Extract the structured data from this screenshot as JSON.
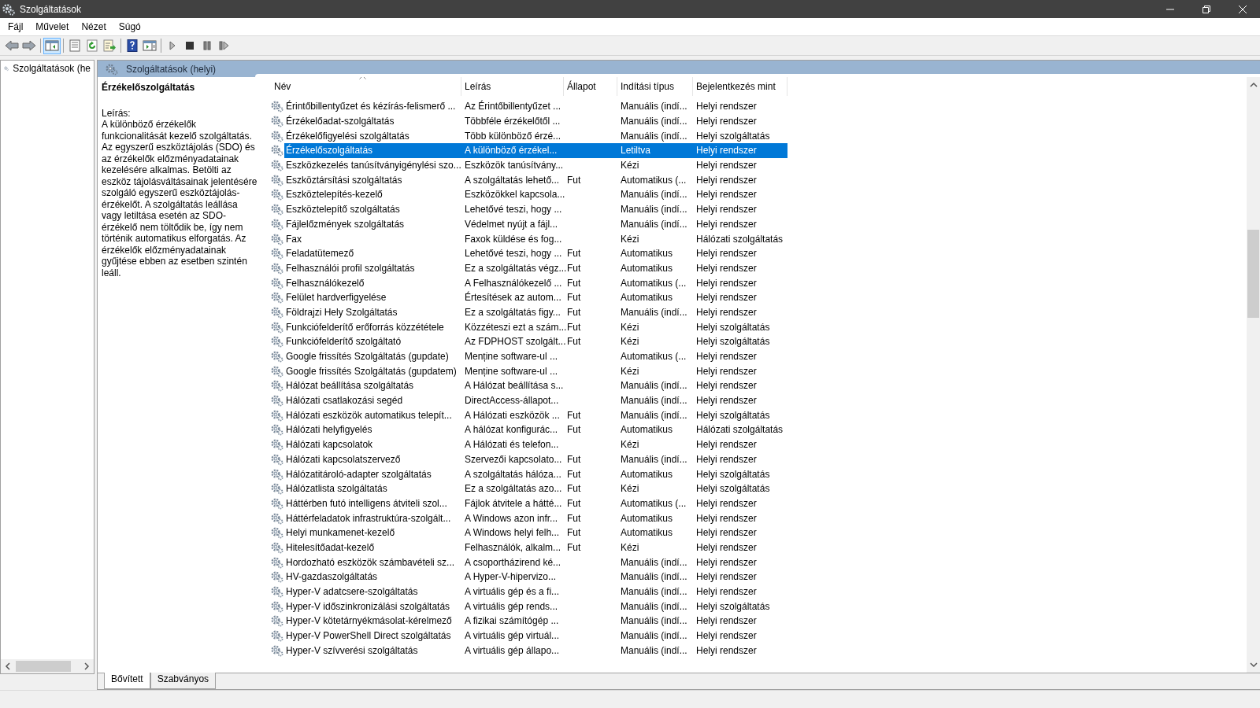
{
  "window": {
    "title": "Szolgáltatások"
  },
  "menu": [
    "Fájl",
    "Művelet",
    "Nézet",
    "Súgó"
  ],
  "toolbar": [
    {
      "kind": "back",
      "pressed": false
    },
    {
      "kind": "forward",
      "pressed": false
    },
    {
      "kind": "separator"
    },
    {
      "kind": "tree",
      "pressed": true
    },
    {
      "kind": "separator"
    },
    {
      "kind": "properties",
      "pressed": false
    },
    {
      "kind": "refresh",
      "pressed": false
    },
    {
      "kind": "export",
      "pressed": false
    },
    {
      "kind": "separator"
    },
    {
      "kind": "help",
      "pressed": false
    },
    {
      "kind": "panel",
      "pressed": false
    },
    {
      "kind": "separator"
    },
    {
      "kind": "play",
      "pressed": false
    },
    {
      "kind": "stop",
      "pressed": false
    },
    {
      "kind": "pause",
      "pressed": false
    },
    {
      "kind": "resume",
      "pressed": false
    }
  ],
  "tree": {
    "items": [
      {
        "label": "Szolgáltatások (he",
        "selected": false
      }
    ]
  },
  "panel": {
    "title": "Szolgáltatások (helyi)"
  },
  "details": {
    "name": "Érzékelőszolgáltatás",
    "label": "Leírás:",
    "text": "A különböző érzékelők funkcionalitását kezelő szolgáltatás. Az egyszerű eszköztájolás (SDO) és az érzékelők előzményadatainak kezelésére alkalmas. Betölti az eszköz tájolásváltásainak jelentésére szolgáló egyszerű eszköztájolás-érzékelőt. A szolgáltatás leállása vagy letiltása esetén az SDO-érzékelő nem töltődik be, így nem történik automatikus elforgatás. Az érzékelők előzményadatainak gyűjtése ebben az esetben szintén leáll."
  },
  "table": {
    "columns": [
      "Név",
      "Leírás",
      "Állapot",
      "Indítási típus",
      "Bejelentkezés mint"
    ],
    "rows": [
      {
        "name": "Érintőbillentyűzet és kézírás-felismerő ...",
        "description": "Az Érintőbillentyűzet ...",
        "status": "",
        "startup": "Manuális (indí...",
        "logon": "Helyi rendszer",
        "selected": false
      },
      {
        "name": "Érzékelőadat-szolgáltatás",
        "description": "Többféle érzékelőtől ...",
        "status": "",
        "startup": "Manuális (indí...",
        "logon": "Helyi rendszer",
        "selected": false
      },
      {
        "name": "Érzékelőfigyelési szolgáltatás",
        "description": "Több különböző érzé...",
        "status": "",
        "startup": "Manuális (indí...",
        "logon": "Helyi szolgáltatás",
        "selected": false
      },
      {
        "name": "Érzékelőszolgáltatás",
        "description": "A különböző érzékel...",
        "status": "",
        "startup": "Letiltva",
        "logon": "Helyi rendszer",
        "selected": true
      },
      {
        "name": "Eszközkezelés tanúsítványigénylési szo...",
        "description": "Eszközök tanúsítvány...",
        "status": "",
        "startup": "Kézi",
        "logon": "Helyi rendszer",
        "selected": false
      },
      {
        "name": "Eszköztársítási szolgáltatás",
        "description": "A szolgáltatás lehető...",
        "status": "Fut",
        "startup": "Automatikus (...",
        "logon": "Helyi rendszer",
        "selected": false
      },
      {
        "name": "Eszköztelepítés-kezelő",
        "description": "Eszközökkel kapcsola...",
        "status": "",
        "startup": "Manuális (indí...",
        "logon": "Helyi rendszer",
        "selected": false
      },
      {
        "name": "Eszköztelepítő szolgáltatás",
        "description": "Lehetővé teszi, hogy ...",
        "status": "",
        "startup": "Manuális (indí...",
        "logon": "Helyi rendszer",
        "selected": false
      },
      {
        "name": "Fájlelőzmények szolgáltatás",
        "description": "Védelmet nyújt a fájl...",
        "status": "",
        "startup": "Manuális (indí...",
        "logon": "Helyi rendszer",
        "selected": false
      },
      {
        "name": "Fax",
        "description": "Faxok küldése és fog...",
        "status": "",
        "startup": "Kézi",
        "logon": "Hálózati szolgáltatás",
        "selected": false
      },
      {
        "name": "Feladatütemező",
        "description": "Lehetővé teszi, hogy ...",
        "status": "Fut",
        "startup": "Automatikus",
        "logon": "Helyi rendszer",
        "selected": false
      },
      {
        "name": "Felhasználói profil szolgáltatás",
        "description": "Ez a szolgáltatás végz...",
        "status": "Fut",
        "startup": "Automatikus",
        "logon": "Helyi rendszer",
        "selected": false
      },
      {
        "name": "Felhasználókezelő",
        "description": "A Felhasználókezelő ...",
        "status": "Fut",
        "startup": "Automatikus (...",
        "logon": "Helyi rendszer",
        "selected": false
      },
      {
        "name": "Felület hardverfigyelése",
        "description": "Értesítések az autom...",
        "status": "Fut",
        "startup": "Automatikus",
        "logon": "Helyi rendszer",
        "selected": false
      },
      {
        "name": "Földrajzi Hely Szolgáltatás",
        "description": "Ez a szolgáltatás figy...",
        "status": "Fut",
        "startup": "Manuális (indí...",
        "logon": "Helyi rendszer",
        "selected": false
      },
      {
        "name": "Funkciófelderítő erőforrás közzététele",
        "description": "Közzéteszi ezt a szám...",
        "status": "Fut",
        "startup": "Kézi",
        "logon": "Helyi szolgáltatás",
        "selected": false
      },
      {
        "name": "Funkciófelderítő szolgáltató",
        "description": "Az FDPHOST szolgált...",
        "status": "Fut",
        "startup": "Kézi",
        "logon": "Helyi szolgáltatás",
        "selected": false
      },
      {
        "name": "Google frissítés Szolgáltatás (gupdate)",
        "description": "Menține software-ul ...",
        "status": "",
        "startup": "Automatikus (...",
        "logon": "Helyi rendszer",
        "selected": false
      },
      {
        "name": "Google frissítés Szolgáltatás (gupdatem)",
        "description": "Menține software-ul ...",
        "status": "",
        "startup": "Kézi",
        "logon": "Helyi rendszer",
        "selected": false
      },
      {
        "name": "Hálózat beállítása szolgáltatás",
        "description": "A Hálózat beállítása s...",
        "status": "",
        "startup": "Manuális (indí...",
        "logon": "Helyi rendszer",
        "selected": false
      },
      {
        "name": "Hálózati csatlakozási segéd",
        "description": "DirectAccess-állapot...",
        "status": "",
        "startup": "Manuális (indí...",
        "logon": "Helyi rendszer",
        "selected": false
      },
      {
        "name": "Hálózati eszközök automatikus telepít...",
        "description": "A Hálózati eszközök ...",
        "status": "Fut",
        "startup": "Manuális (indí...",
        "logon": "Helyi szolgáltatás",
        "selected": false
      },
      {
        "name": "Hálózati helyfigyelés",
        "description": "A hálózat konfigurác...",
        "status": "Fut",
        "startup": "Automatikus",
        "logon": "Hálózati szolgáltatás",
        "selected": false
      },
      {
        "name": "Hálózati kapcsolatok",
        "description": "A Hálózati és telefon...",
        "status": "",
        "startup": "Kézi",
        "logon": "Helyi rendszer",
        "selected": false
      },
      {
        "name": "Hálózati kapcsolatszervező",
        "description": "Szervezői kapcsolato...",
        "status": "Fut",
        "startup": "Manuális (indí...",
        "logon": "Helyi rendszer",
        "selected": false
      },
      {
        "name": "Hálózatitároló-adapter szolgáltatás",
        "description": "A szolgáltatás hálóza...",
        "status": "Fut",
        "startup": "Automatikus",
        "logon": "Helyi szolgáltatás",
        "selected": false
      },
      {
        "name": "Hálózatlista szolgáltatás",
        "description": "Ez a szolgáltatás azo...",
        "status": "Fut",
        "startup": "Kézi",
        "logon": "Helyi szolgáltatás",
        "selected": false
      },
      {
        "name": "Háttérben futó intelligens átviteli szol...",
        "description": "Fájlok átvitele a hátté...",
        "status": "Fut",
        "startup": "Automatikus (...",
        "logon": "Helyi rendszer",
        "selected": false
      },
      {
        "name": "Háttérfeladatok infrastruktúra-szolgált...",
        "description": "A Windows azon infr...",
        "status": "Fut",
        "startup": "Automatikus",
        "logon": "Helyi rendszer",
        "selected": false
      },
      {
        "name": "Helyi munkamenet-kezelő",
        "description": "A Windows helyi felh...",
        "status": "Fut",
        "startup": "Automatikus",
        "logon": "Helyi rendszer",
        "selected": false
      },
      {
        "name": "Hitelesítőadat-kezelő",
        "description": "Felhasználók, alkalm...",
        "status": "Fut",
        "startup": "Kézi",
        "logon": "Helyi rendszer",
        "selected": false
      },
      {
        "name": "Hordozható eszközök számbavételi sz...",
        "description": "A csoportházirend ké...",
        "status": "",
        "startup": "Manuális (indí...",
        "logon": "Helyi rendszer",
        "selected": false
      },
      {
        "name": "HV-gazdaszolgáltatás",
        "description": "A Hyper-V-hipervizo...",
        "status": "",
        "startup": "Manuális (indí...",
        "logon": "Helyi rendszer",
        "selected": false
      },
      {
        "name": "Hyper-V adatcsere-szolgáltatás",
        "description": "A virtuális gép és a fi...",
        "status": "",
        "startup": "Manuális (indí...",
        "logon": "Helyi rendszer",
        "selected": false
      },
      {
        "name": "Hyper-V időszinkronizálási szolgáltatás",
        "description": "A virtuális gép rends...",
        "status": "",
        "startup": "Manuális (indí...",
        "logon": "Helyi szolgáltatás",
        "selected": false
      },
      {
        "name": "Hyper-V kötetárnyékmásolat-kérelmező",
        "description": "A fizikai számítógép ...",
        "status": "",
        "startup": "Manuális (indí...",
        "logon": "Helyi rendszer",
        "selected": false
      },
      {
        "name": "Hyper-V PowerShell Direct szolgáltatás",
        "description": "A virtuális gép virtuál...",
        "status": "",
        "startup": "Manuális (indí...",
        "logon": "Helyi rendszer",
        "selected": false
      },
      {
        "name": "Hyper-V szívverési szolgáltatás",
        "description": "A virtuális gép állapo...",
        "status": "",
        "startup": "Manuális (indí...",
        "logon": "Helyi rendszer",
        "selected": false
      }
    ]
  },
  "tabs": [
    {
      "label": "Bővített",
      "selected": true
    },
    {
      "label": "Szabványos",
      "selected": false
    }
  ]
}
